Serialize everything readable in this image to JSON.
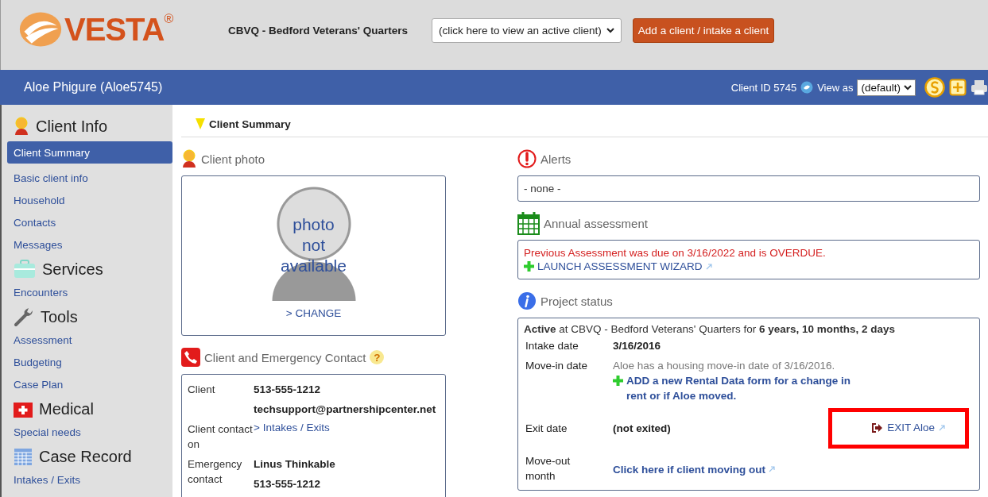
{
  "header": {
    "logo": "VESTA",
    "logo_mark": "®",
    "agency": "CBVQ - Bedford Veterans' Quarters",
    "client_select": "(click here to view an active client)",
    "add_button": "Add a client / intake a client"
  },
  "client_bar": {
    "name": "Aloe Phigure (Aloe5745)",
    "client_id": "Client ID 5745",
    "view_as_label": "View as",
    "view_select": "(default)"
  },
  "sidebar": {
    "sections": [
      {
        "title": "Client Info",
        "kind": "person",
        "items": [
          {
            "label": "Client Summary",
            "selected": true
          },
          {
            "label": "Basic client info",
            "selected": false
          },
          {
            "label": "Household",
            "selected": false
          },
          {
            "label": "Contacts",
            "selected": false
          },
          {
            "label": "Messages",
            "selected": false
          }
        ]
      },
      {
        "title": "Services",
        "kind": "briefcase",
        "items": [
          {
            "label": "Encounters",
            "selected": false
          }
        ]
      },
      {
        "title": "Tools",
        "kind": "wrench",
        "items": [
          {
            "label": "Assessment",
            "selected": false
          },
          {
            "label": "Budgeting",
            "selected": false
          },
          {
            "label": "Case Plan",
            "selected": false
          }
        ]
      },
      {
        "title": "Medical",
        "kind": "medkit",
        "items": [
          {
            "label": "Special needs",
            "selected": false
          }
        ]
      },
      {
        "title": "Case Record",
        "kind": "calendar",
        "items": [
          {
            "label": "Intakes / Exits",
            "selected": false
          }
        ]
      }
    ]
  },
  "breadcrumb": "Client Summary",
  "photo_panel": {
    "title": "Client photo",
    "photo_text": "photo not available",
    "change_link": "> CHANGE"
  },
  "contact_panel": {
    "title": "Client and Emergency Contact",
    "help": "?",
    "rows": [
      {
        "label": "Client",
        "values": [
          {
            "text": "513-555-1212",
            "kind": "text"
          },
          {
            "text": "techsupport@partnershipcenter.net",
            "kind": "text"
          }
        ]
      },
      {
        "label": "Client contact on",
        "values": [
          {
            "text": "> Intakes / Exits",
            "kind": "link"
          }
        ]
      },
      {
        "label": "Emergency contact",
        "values": [
          {
            "text": "Linus Thinkable",
            "kind": "text"
          },
          {
            "text": "513-555-1212",
            "kind": "text"
          }
        ]
      }
    ]
  },
  "alerts": {
    "title": "Alerts",
    "text": "- none -"
  },
  "assessment": {
    "title": "Annual assessment",
    "warning": "Previous Assessment was due on 3/16/2022 and is OVERDUE.",
    "link": "LAUNCH ASSESSMENT WIZARD"
  },
  "project_status": {
    "title": "Project status",
    "summary": "**Active** at CBVQ - Bedford Veterans' Quarters for **6 years, 10 months, 2 days**",
    "intake_label": "Intake date",
    "intake_date": "3/16/2016",
    "movein_label": "Move-in date",
    "movein_text": "Aloe has a housing move-in date of 3/16/2016.",
    "rental_link": "ADD a new Rental Data form for a change in rent or if Aloe moved.",
    "exit_label": "Exit date",
    "exit_value": "(not exited)",
    "exit_link": "EXIT Aloe",
    "exit_highlighted": true,
    "moveout_label": "Move-out month",
    "moveout_link": "Click here if client moving out"
  }
}
